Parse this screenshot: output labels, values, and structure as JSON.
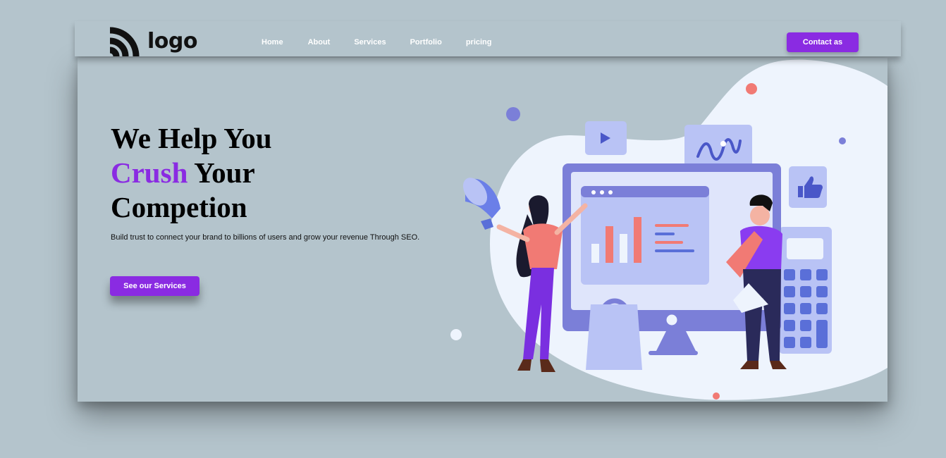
{
  "logo": {
    "text": "logo",
    "icon": "signal-waves-icon"
  },
  "nav": {
    "items": [
      {
        "label": "Home"
      },
      {
        "label": "About"
      },
      {
        "label": "Services"
      },
      {
        "label": "Portfolio"
      },
      {
        "label": "pricing"
      }
    ]
  },
  "header": {
    "contact_label": "Contact as"
  },
  "hero": {
    "title_line1": "We Help You",
    "title_accent": "Crush",
    "title_line2_rest": " Your",
    "title_line3": "Competion",
    "subtitle": "Build trust to connect your brand to billions of users and grow your revenue Through SEO.",
    "cta_label": "See our Services"
  },
  "colors": {
    "background": "#b4c4cc",
    "accent": "#8a2be2",
    "blob": "#eef4fd",
    "illustration_primary": "#7b7fd8",
    "illustration_light": "#b9c3f5",
    "chart_bar": "#f17a74"
  }
}
